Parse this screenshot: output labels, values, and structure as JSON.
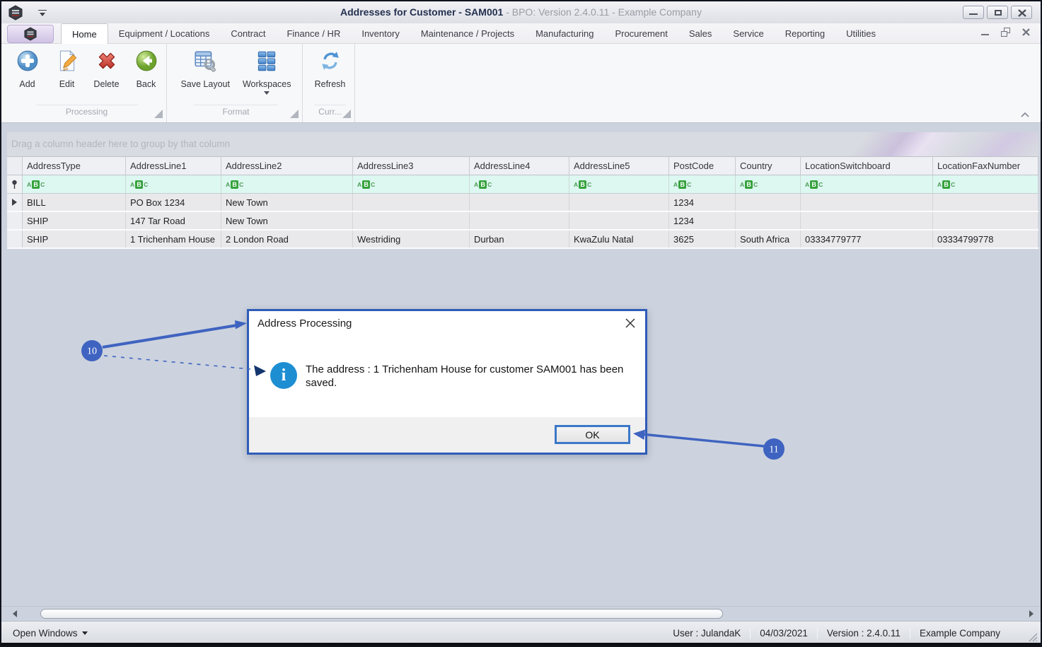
{
  "window": {
    "title_main": "Addresses for Customer - SAM001",
    "title_sub": " - BPO: Version 2.4.0.11 - Example Company"
  },
  "tabs": [
    {
      "label": "Home",
      "active": true
    },
    {
      "label": "Equipment / Locations",
      "active": false
    },
    {
      "label": "Contract",
      "active": false
    },
    {
      "label": "Finance / HR",
      "active": false
    },
    {
      "label": "Inventory",
      "active": false
    },
    {
      "label": "Maintenance / Projects",
      "active": false
    },
    {
      "label": "Manufacturing",
      "active": false
    },
    {
      "label": "Procurement",
      "active": false
    },
    {
      "label": "Sales",
      "active": false
    },
    {
      "label": "Service",
      "active": false
    },
    {
      "label": "Reporting",
      "active": false
    },
    {
      "label": "Utilities",
      "active": false
    }
  ],
  "ribbon": {
    "groups": [
      {
        "label": "Processing",
        "buttons": [
          {
            "id": "add",
            "label": "Add"
          },
          {
            "id": "edit",
            "label": "Edit"
          },
          {
            "id": "delete",
            "label": "Delete"
          },
          {
            "id": "back",
            "label": "Back"
          }
        ]
      },
      {
        "label": "Format",
        "buttons": [
          {
            "id": "save-layout",
            "label": "Save Layout"
          },
          {
            "id": "workspaces",
            "label": "Workspaces",
            "dropdown": true
          }
        ]
      },
      {
        "label": "Curr...",
        "buttons": [
          {
            "id": "refresh",
            "label": "Refresh"
          }
        ]
      }
    ]
  },
  "grid": {
    "group_hint": "Drag a column header here to group by that column",
    "filter_badge": "ABC",
    "columns": [
      "AddressType",
      "AddressLine1",
      "AddressLine2",
      "AddressLine3",
      "AddressLine4",
      "AddressLine5",
      "PostCode",
      "Country",
      "LocationSwitchboard",
      "LocationFaxNumber"
    ],
    "rows": [
      [
        "BILL",
        "PO Box 1234",
        "New Town",
        "",
        "",
        "",
        "1234",
        "",
        "",
        ""
      ],
      [
        "SHIP",
        "147 Tar Road",
        "New Town",
        "",
        "",
        "",
        "1234",
        "",
        "",
        ""
      ],
      [
        "SHIP",
        "1 Trichenham House",
        "2 London Road",
        "Westriding",
        "Durban",
        "KwaZulu Natal",
        "3625",
        "South Africa",
        "03334779777",
        "03334799778"
      ]
    ]
  },
  "dialog": {
    "title": "Address Processing",
    "message": "The address : 1 Trichenham House for customer SAM001 has been saved.",
    "ok_label": "OK"
  },
  "statusbar": {
    "open_windows": "Open Windows",
    "user": "User : JulandaK",
    "date": "04/03/2021",
    "version": "Version : 2.4.0.11",
    "company": "Example Company"
  },
  "annotations": {
    "callout_10": "10",
    "callout_11": "11",
    "accent_color": "#3f63c0"
  }
}
